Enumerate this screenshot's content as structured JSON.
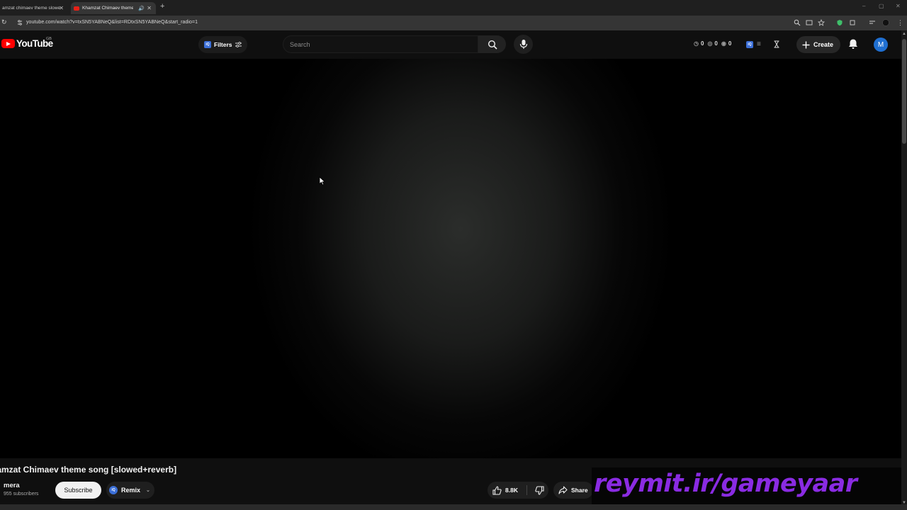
{
  "browser": {
    "tabs": [
      {
        "title": "amzat chimaev theme slowe",
        "active": false
      },
      {
        "title": "Khamzat Chimaev theme s",
        "active": true
      }
    ],
    "url": "youtube.com/watch?v=txSN5YABNeQ&list=RDtxSN5YABNeQ&start_radio=1"
  },
  "masthead": {
    "logo_text": "YouTube",
    "country_code": "GB",
    "filters_label": "Filters",
    "iq_badge": "iQ",
    "search_placeholder": "Search",
    "ext_stats": [
      "0",
      "0",
      "0"
    ],
    "create_label": "Create",
    "avatar_letter": "M"
  },
  "video": {
    "title": "hamzat Chimaev theme song [slowed+reverb]",
    "channel": "mera",
    "subscribers": "955 subscribers",
    "subscribe_label": "Subscribe",
    "remix_label": "Remix",
    "likes": "8.8K",
    "share_label": "Share"
  },
  "overlay": {
    "watermark": "reymit.ir/gameyaar",
    "watermark_color": "#8a2be2"
  },
  "colors": {
    "youtube_red": "#ff0000",
    "background": "#0f0f0f",
    "avatar_bg": "#1f6fd1"
  }
}
